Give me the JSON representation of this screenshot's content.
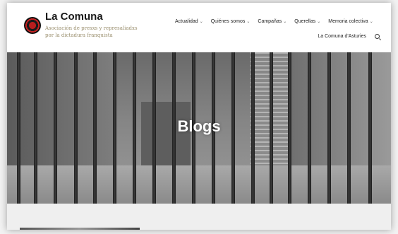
{
  "site": {
    "title": "La Comuna",
    "tagline": "Asociación de presxs y represaliadxs por la dictadura franquista"
  },
  "nav": {
    "row1": [
      {
        "label": "Actualidad",
        "dropdown": true
      },
      {
        "label": "Quiénes somos",
        "dropdown": true
      },
      {
        "label": "Campañas",
        "dropdown": true
      },
      {
        "label": "Querellas",
        "dropdown": true
      },
      {
        "label": "Memoria colectiva",
        "dropdown": true
      }
    ],
    "row2": [
      {
        "label": "La Comuna d'Asturies",
        "dropdown": false
      }
    ]
  },
  "hero": {
    "title": "Blogs"
  },
  "icons": {
    "logo": "red-star-logo",
    "search": "search-icon",
    "dropdown": "chevron-down-icon"
  }
}
